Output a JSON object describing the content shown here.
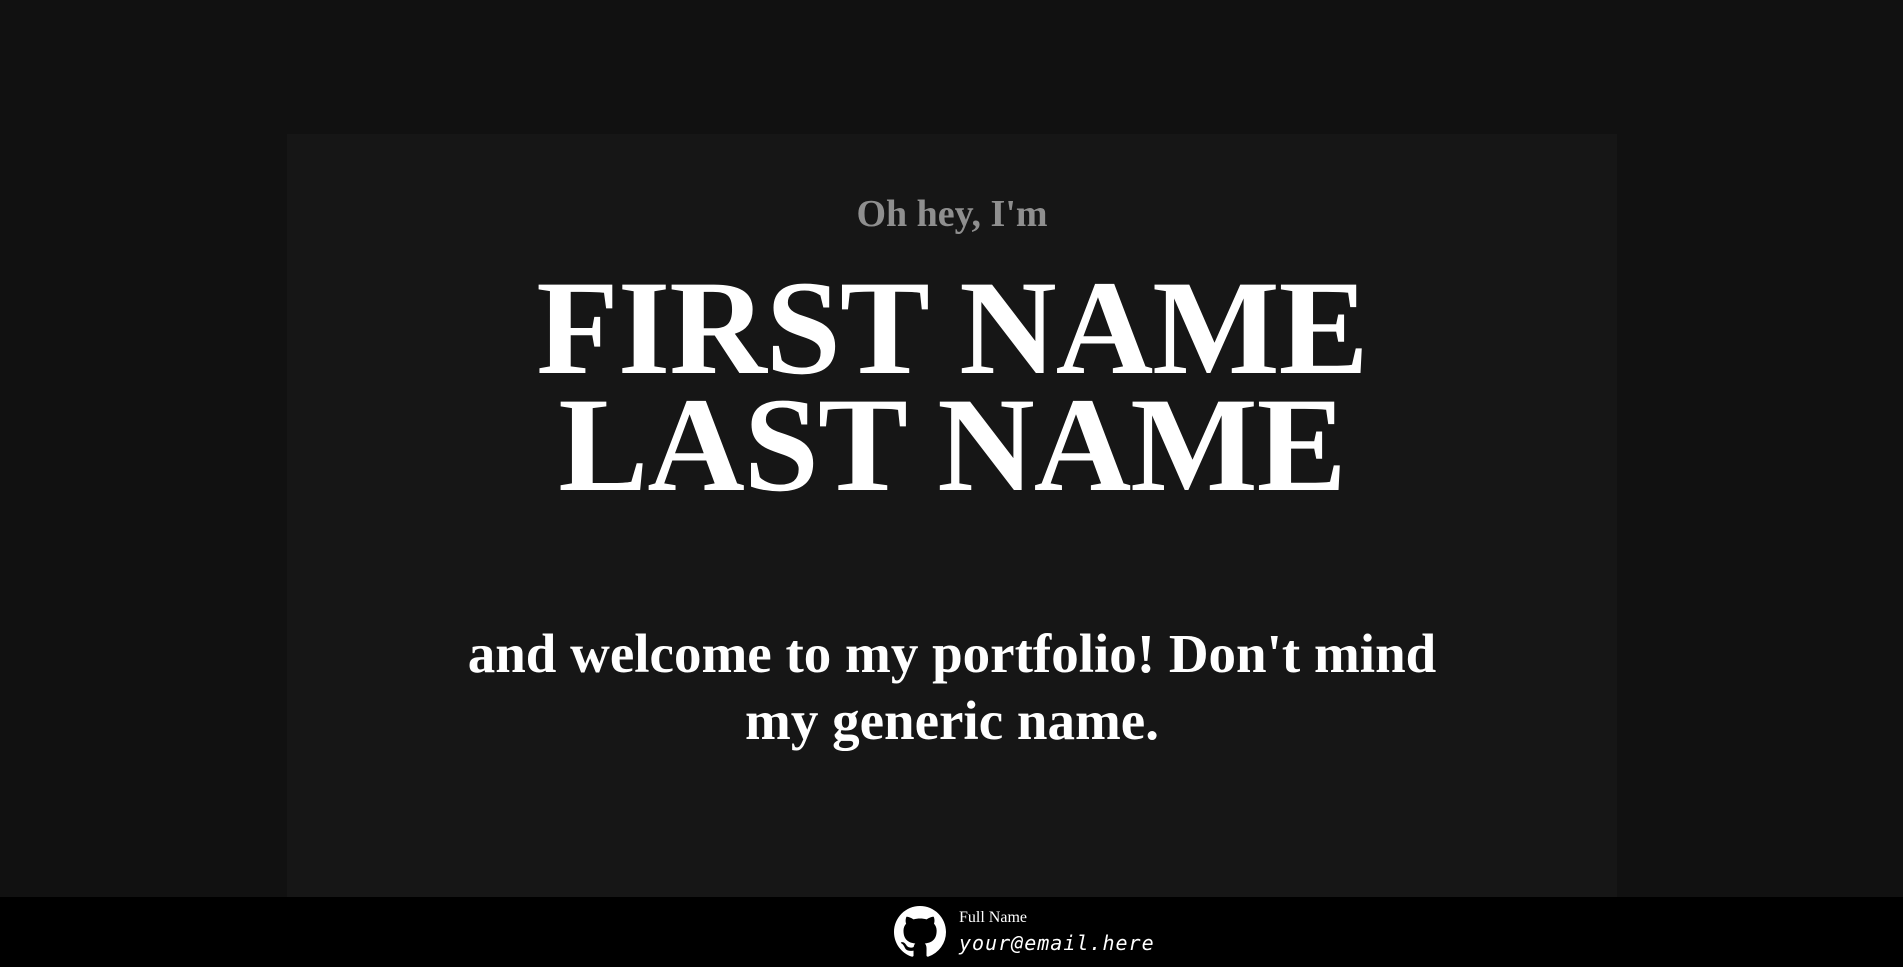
{
  "hero": {
    "greeting": "Oh hey, I'm",
    "first_name": "FIRST NAME",
    "last_name": "LAST NAME",
    "welcome": "and welcome to my portfolio! Don't mind my generic name."
  },
  "footer": {
    "icon": "github-icon",
    "full_name": "Full Name",
    "email": "your@email.here"
  },
  "colors": {
    "background": "#111111",
    "hero_panel": "#161616",
    "footer": "#000000",
    "greeting": "#8f8f8f",
    "text": "#ffffff"
  }
}
